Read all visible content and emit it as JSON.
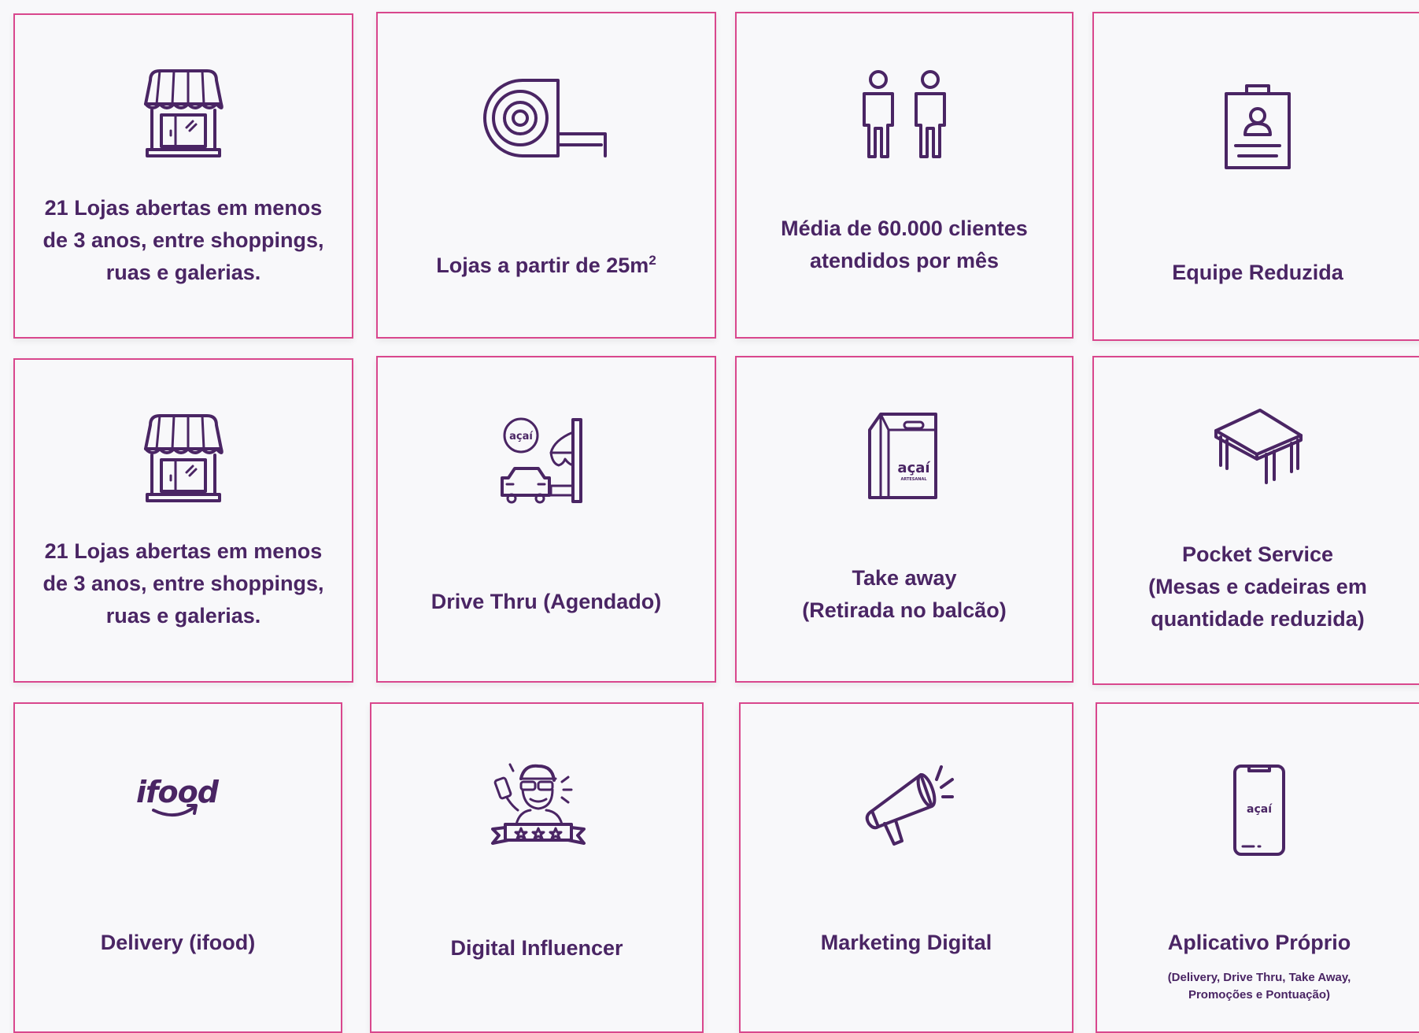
{
  "cards": [
    {
      "icon": "storefront-icon",
      "lines": [
        "21 Lojas abertas em menos",
        "de 3 anos, entre shoppings,",
        "ruas e galerias."
      ]
    },
    {
      "icon": "measuring-tape-icon",
      "text": "Lojas a partir de 25m",
      "superscript": "2"
    },
    {
      "icon": "people-icon",
      "lines": [
        "Média de 60.000 clientes",
        "atendidos por mês"
      ]
    },
    {
      "icon": "badge-icon",
      "lines": [
        "Equipe Reduzida"
      ]
    },
    {
      "icon": "storefront-icon",
      "lines": [
        "21 Lojas abertas em menos",
        "de 3 anos, entre shoppings,",
        "ruas e galerias."
      ]
    },
    {
      "icon": "drive-thru-icon",
      "icon_text": "açaí",
      "lines": [
        "Drive Thru (Agendado)"
      ]
    },
    {
      "icon": "takeaway-bag-icon",
      "icon_text": "açaí",
      "icon_subtext": "ARTESANAL",
      "lines": [
        "Take away",
        "(Retirada no balcão)"
      ]
    },
    {
      "icon": "table-icon",
      "lines": [
        "Pocket Service",
        "(Mesas e cadeiras em",
        "quantidade reduzida)"
      ]
    },
    {
      "icon": "ifood-logo-icon",
      "icon_text": "ifood",
      "lines": [
        "Delivery (ifood)"
      ]
    },
    {
      "icon": "influencer-icon",
      "lines": [
        "Digital Influencer"
      ]
    },
    {
      "icon": "megaphone-icon",
      "lines": [
        "Marketing Digital"
      ]
    },
    {
      "icon": "smartphone-app-icon",
      "icon_text": "açaí",
      "lines": [
        "Aplicativo Próprio"
      ],
      "subtext": [
        "(Delivery, Drive Thru, Take Away,",
        "Promoções e Pontuação)"
      ]
    }
  ]
}
